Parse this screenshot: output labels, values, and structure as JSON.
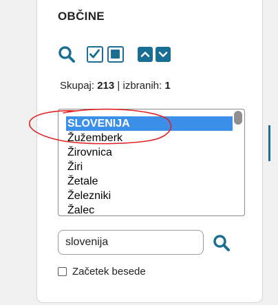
{
  "panel": {
    "title": "OBČINE",
    "summary": {
      "total_label": "Skupaj:",
      "total_value": "213",
      "separator": "|",
      "selected_label": "izbranih:",
      "selected_value": "1"
    },
    "list": {
      "items": [
        "SLOVENIJA",
        "Žužemberk",
        "Žirovnica",
        "Žiri",
        "Žetale",
        "Železniki",
        "Žalec"
      ],
      "selected_index": 0
    },
    "search": {
      "value": "slovenija"
    },
    "checkbox": {
      "label": "Začetek besede",
      "checked": false
    }
  },
  "toolbar": {
    "icons": [
      "search-icon",
      "select-all-icon",
      "deselect-all-icon",
      "chevron-up-icon",
      "chevron-down-icon"
    ]
  },
  "colors": {
    "accent": "#1b6e93",
    "selection": "#3c8fe8",
    "annotation": "#e02020"
  }
}
